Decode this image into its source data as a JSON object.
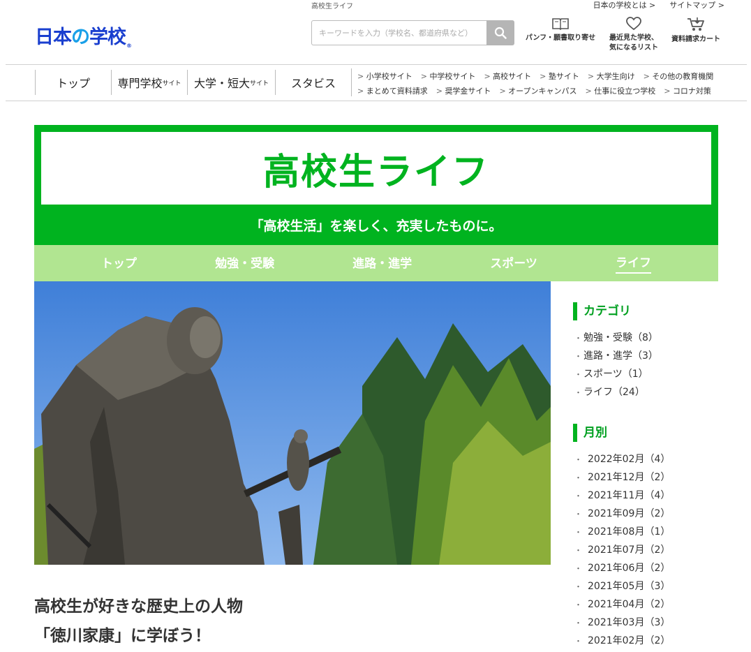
{
  "header": {
    "logo": {
      "part1": "日本",
      "part2": "の",
      "part3": "学校",
      "reg": "®"
    },
    "breadcrumb": "高校生ライフ",
    "util_links": [
      "日本の学校とは",
      "サイトマップ"
    ],
    "search_placeholder": "キーワードを入力（学校名、都道府県など）",
    "icons": [
      {
        "label": "パンフ・願書取り寄せ",
        "icon": "book-icon"
      },
      {
        "label_line1": "最近見た学校、",
        "label_line2": "気になるリスト",
        "icon": "heart-icon"
      },
      {
        "label": "資料請求カート",
        "icon": "cart-icon"
      }
    ]
  },
  "gnav": {
    "items": [
      {
        "label": "トップ",
        "suffix": ""
      },
      {
        "label": "専門学校",
        "suffix": "サイト"
      },
      {
        "label": "大学・短大",
        "suffix": "サイト"
      },
      {
        "label": "スタビス",
        "suffix": ""
      }
    ],
    "sub_row1": [
      "小学校サイト",
      "中学校サイト",
      "高校サイト",
      "塾サイト",
      "大学生向け",
      "その他の教育機関"
    ],
    "sub_row2": [
      "まとめて資料請求",
      "奨学金サイト",
      "オープンキャンパス",
      "仕事に役立つ学校",
      "コロナ対策"
    ]
  },
  "hero": {
    "title": "高校生ライフ",
    "tagline": "「高校生活」を楽しく、充実したものに。"
  },
  "catnav": {
    "items": [
      "トップ",
      "勉強・受験",
      "進路・進学",
      "スポーツ",
      "ライフ"
    ],
    "active_index": 4
  },
  "article": {
    "title_line1": "高校生が好きな歴史上の人物",
    "title_line2": "「徳川家康」に学ぼう！"
  },
  "sidebar": {
    "category_heading": "カテゴリ",
    "categories": [
      "勉強・受験（8）",
      "進路・進学（3）",
      "スポーツ（1）",
      "ライフ（24）"
    ],
    "monthly_heading": "月別",
    "months": [
      "2022年02月（4）",
      "2021年12月（2）",
      "2021年11月（4）",
      "2021年09月（2）",
      "2021年08月（1）",
      "2021年07月（2）",
      "2021年06月（2）",
      "2021年05月（3）",
      "2021年04月（2）",
      "2021年03月（3）",
      "2021年02月（2）"
    ]
  },
  "colors": {
    "brand_green": "#00b31f",
    "light_green": "#b1e591",
    "logo_blue": "#1a3fcf"
  }
}
